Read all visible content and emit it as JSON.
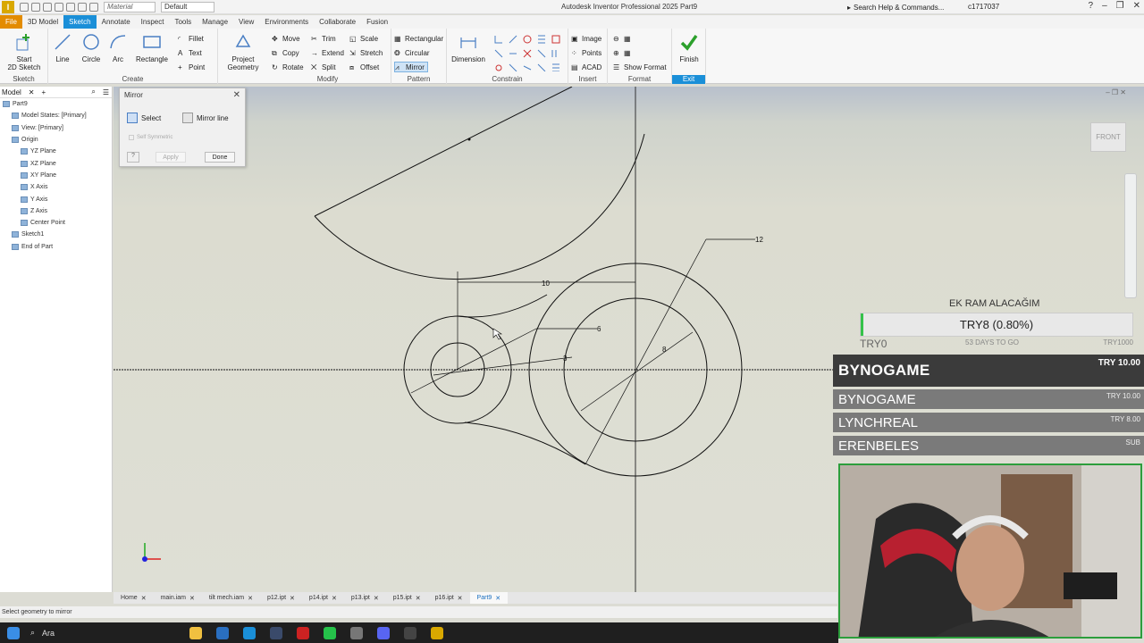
{
  "titlebar": {
    "app_logo": "I",
    "material": "Material",
    "appearance": "Default",
    "title": "Autodesk Inventor Professional 2025   Part9",
    "help_search": "Search Help & Commands...",
    "user": "c1717037"
  },
  "menu_tabs": [
    "File",
    "3D Model",
    "Sketch",
    "Annotate",
    "Inspect",
    "Tools",
    "Manage",
    "View",
    "Environments",
    "Collaborate",
    "Fusion"
  ],
  "active_tab": "Sketch",
  "ribbon": {
    "sketch_group": {
      "label": "Sketch",
      "start": "Start\n2D Sketch"
    },
    "create_group": {
      "label": "Create",
      "line": "Line",
      "circle": "Circle",
      "arc": "Arc",
      "rectangle": "Rectangle",
      "fillet": "Fillet",
      "text": "Text",
      "point": "Point"
    },
    "project_geometry": "Project\nGeometry",
    "modify_group": {
      "label": "Modify",
      "move": "Move",
      "trim": "Trim",
      "scale": "Scale",
      "copy": "Copy",
      "extend": "Extend",
      "stretch": "Stretch",
      "rotate": "Rotate",
      "split": "Split",
      "offset": "Offset"
    },
    "pattern_group": {
      "label": "Pattern",
      "rectangular": "Rectangular",
      "circular": "Circular",
      "mirror": "Mirror"
    },
    "constrain_group": {
      "label": "Constrain",
      "dimension": "Dimension"
    },
    "insert_group": {
      "label": "Insert",
      "image": "Image",
      "points": "Points",
      "acad": "ACAD"
    },
    "format_group": {
      "label": "Format",
      "show_format": "Show Format"
    },
    "exit_group": {
      "label": "Exit",
      "finish": "Finish"
    }
  },
  "browser": {
    "tab": "Model",
    "plus": "+",
    "items": [
      {
        "label": "Part9",
        "indent": 0
      },
      {
        "label": "Model States: [Primary]",
        "indent": 1
      },
      {
        "label": "View: [Primary]",
        "indent": 1
      },
      {
        "label": "Origin",
        "indent": 1
      },
      {
        "label": "YZ Plane",
        "indent": 2
      },
      {
        "label": "XZ Plane",
        "indent": 2
      },
      {
        "label": "XY Plane",
        "indent": 2
      },
      {
        "label": "X Axis",
        "indent": 2
      },
      {
        "label": "Y Axis",
        "indent": 2
      },
      {
        "label": "Z Axis",
        "indent": 2
      },
      {
        "label": "Center Point",
        "indent": 2
      },
      {
        "label": "Sketch1",
        "indent": 1
      },
      {
        "label": "End of Part",
        "indent": 1
      }
    ]
  },
  "mirror_dialog": {
    "title": "Mirror",
    "select": "Select",
    "mirror_line": "Mirror line",
    "self_symmetric": "Self Symmetric",
    "help": "?",
    "apply": "Apply",
    "done": "Done"
  },
  "canvas": {
    "viewcube": "FRONT",
    "dimensions": {
      "d10": "10",
      "d12": "12",
      "d6": "6",
      "d8": "8",
      "d3": "3"
    }
  },
  "overlay": {
    "title": "EK RAM ALACAĞIM",
    "goal": "TRY8 (0.80%)",
    "goal_progress_percent": 0.8,
    "start": "TRY0",
    "days": "53 DAYS TO GO",
    "target": "TRY1000",
    "top_donor": {
      "name": "BYNOGAME",
      "amount": "TRY 10.00"
    },
    "donors": [
      {
        "name": "BYNOGAME",
        "amount": "TRY 10.00"
      },
      {
        "name": "LYNCHREAL",
        "amount": "TRY 8.00"
      },
      {
        "name": "ERENBELES",
        "amount": "SUB"
      }
    ]
  },
  "doc_tabs": [
    {
      "label": "Home",
      "active": false
    },
    {
      "label": "main.iam",
      "active": false
    },
    {
      "label": "tilt mech.iam",
      "active": false
    },
    {
      "label": "p12.ipt",
      "active": false
    },
    {
      "label": "p14.ipt",
      "active": false
    },
    {
      "label": "p13.ipt",
      "active": false
    },
    {
      "label": "p15.ipt",
      "active": false
    },
    {
      "label": "p16.ipt",
      "active": false
    },
    {
      "label": "Part9",
      "active": true
    }
  ],
  "status": "Select geometry to mirror",
  "taskbar": {
    "search": "Ara"
  },
  "colors": {
    "accent": "#1a8fd8",
    "file_tab": "#e38c00",
    "finish_green": "#2ca02c",
    "progress_green": "#35c24a"
  }
}
